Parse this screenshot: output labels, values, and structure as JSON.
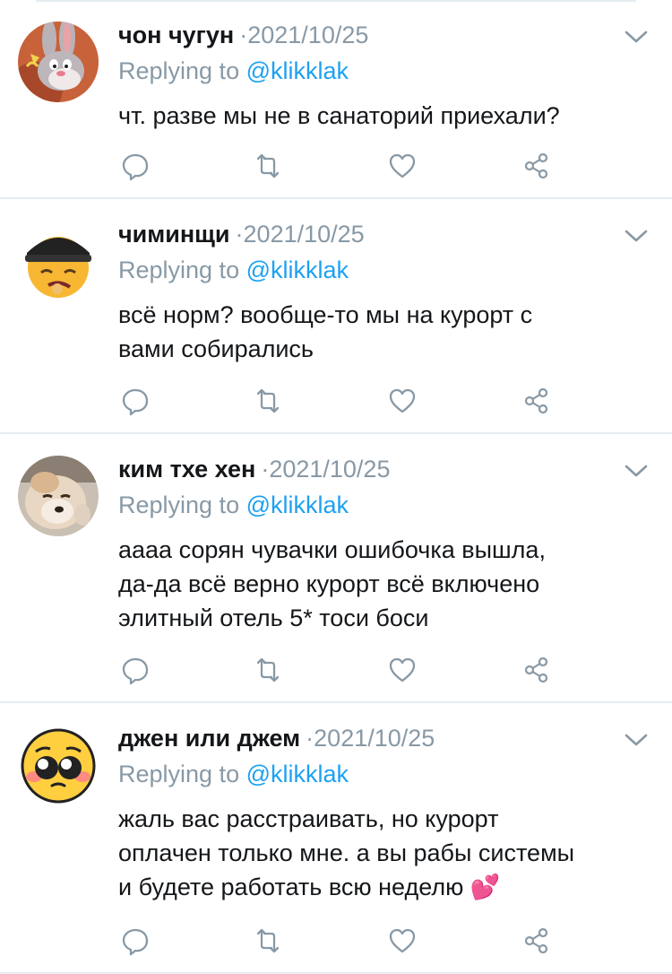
{
  "tweets": [
    {
      "name": "чон чугун",
      "date": "·2021/10/25",
      "replying_prefix": "Replying to",
      "handle": "@klikklak",
      "lines": [
        "чт. разве мы не в санаторий приехали?"
      ],
      "avatar_icon": "bunny-avatar-icon"
    },
    {
      "name": "чиминщи",
      "date": "·2021/10/25",
      "replying_prefix": "Replying to",
      "handle": "@klikklak",
      "lines": [
        "всё норм? вообще-то мы на курорт с",
        "вами собирались"
      ],
      "avatar_icon": "emoji-cap-avatar-icon"
    },
    {
      "name": "ким тхе хен",
      "date": "·2021/10/25",
      "replying_prefix": "Replying to",
      "handle": "@klikklak",
      "lines": [
        "аааа сорян чувачки ошибочка вышла,",
        "да-да всё верно курорт всё включено",
        "элитный отель 5* тоси боси"
      ],
      "avatar_icon": "dog-avatar-icon"
    },
    {
      "name": "джен или джем",
      "date": "·2021/10/25",
      "replying_prefix": "Replying to",
      "handle": "@klikklak",
      "lines": [
        "жаль вас расстраивать, но курорт",
        "оплачен только мне. а вы рабы системы",
        "и будете работать всю неделю"
      ],
      "end_emoji": "💕",
      "avatar_icon": "pleading-emoji-avatar-icon"
    }
  ],
  "colors": {
    "text": "#14171a",
    "secondary": "#8899a6",
    "link": "#1da1f2",
    "divider": "#e6ecf0"
  }
}
